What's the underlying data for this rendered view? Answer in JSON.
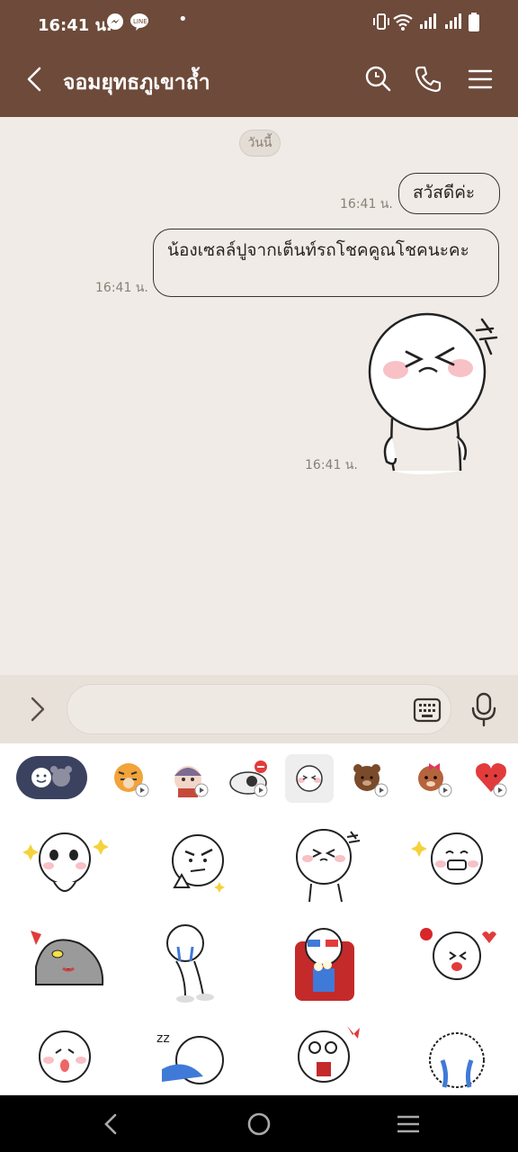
{
  "status_bar": {
    "time": "16:41 น.",
    "dot": "•"
  },
  "header": {
    "title": "จอมยุทธภูเขาถ้ำ"
  },
  "chat": {
    "date_label": "วันนี้",
    "messages": [
      {
        "text": "สวัสดีค่ะ",
        "time": "16:41 น."
      },
      {
        "text": "น้องเซลล์ปูจากเต็นท์รถโชคคูณโชคนะคะ",
        "time": "16:41 น."
      },
      {
        "text": "",
        "time": "16:41 น.",
        "sticker": "laughing-face-sticker"
      }
    ]
  },
  "input": {
    "placeholder": ""
  },
  "sticker_tabs": [
    "emoji-tab",
    "tiger-sticker-tab",
    "girl-sticker-tab",
    "bear-sticker-tab",
    "moon-sticker-tab",
    "brown-sticker-tab",
    "choco-sticker-tab",
    "heart-sticker-tab"
  ],
  "colors": {
    "header": "#6d4a3a",
    "chat_bg": "#f0ebe6"
  }
}
